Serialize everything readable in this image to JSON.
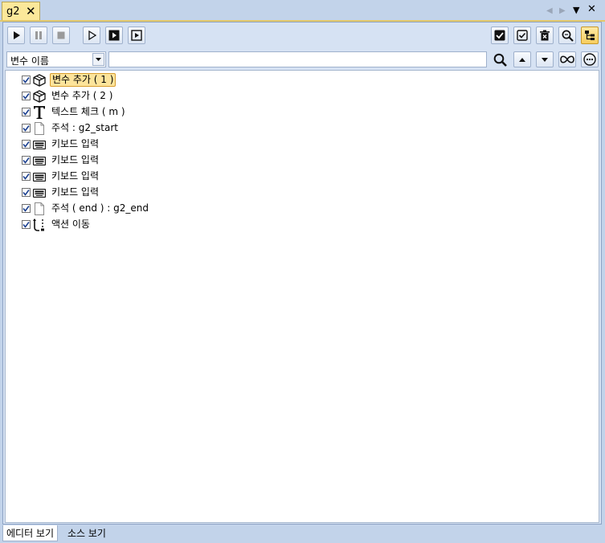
{
  "tab": {
    "label": "g2",
    "close": "✕"
  },
  "window_controls": {
    "prev": "◀",
    "next": "▶",
    "menu": "▼",
    "close": "✕"
  },
  "toolbar": {
    "left": [
      "play-icon",
      "pause-icon",
      "stop-icon",
      "step-icon",
      "run-selected-icon",
      "run-from-icon"
    ],
    "right": [
      "check-all-icon",
      "check-icon",
      "delete-icon",
      "zoom-icon",
      "tree-view-icon"
    ]
  },
  "search": {
    "field_selected": "변수 이름",
    "value": "",
    "placeholder": ""
  },
  "tree_items": [
    {
      "label": "변수 추가 ( 1 )",
      "icon": "cube-icon",
      "checked": true,
      "selected": true
    },
    {
      "label": "변수 추가 ( 2 )",
      "icon": "cube-icon",
      "checked": true
    },
    {
      "label": "텍스트 체크 ( m )",
      "icon": "text-t-icon",
      "checked": true
    },
    {
      "label": "주석 : g2_start",
      "icon": "note-icon",
      "checked": true
    },
    {
      "label": "키보드 입력",
      "icon": "keyboard-icon",
      "checked": true
    },
    {
      "label": "키보드 입력",
      "icon": "keyboard-icon",
      "checked": true
    },
    {
      "label": "키보드 입력",
      "icon": "keyboard-icon",
      "checked": true
    },
    {
      "label": "키보드 입력",
      "icon": "keyboard-icon",
      "checked": true
    },
    {
      "label": "주석 ( end ) : g2_end",
      "icon": "note-icon",
      "checked": true
    },
    {
      "label": "액션 이동",
      "icon": "move-action-icon",
      "checked": true
    }
  ],
  "bottom_tabs": [
    {
      "label": "에디터 보기",
      "active": true
    },
    {
      "label": "소스 보기",
      "active": false
    }
  ],
  "colors": {
    "accent": "#fde49b",
    "panel": "#d6e2f3",
    "frame": "#c2d3ea"
  }
}
